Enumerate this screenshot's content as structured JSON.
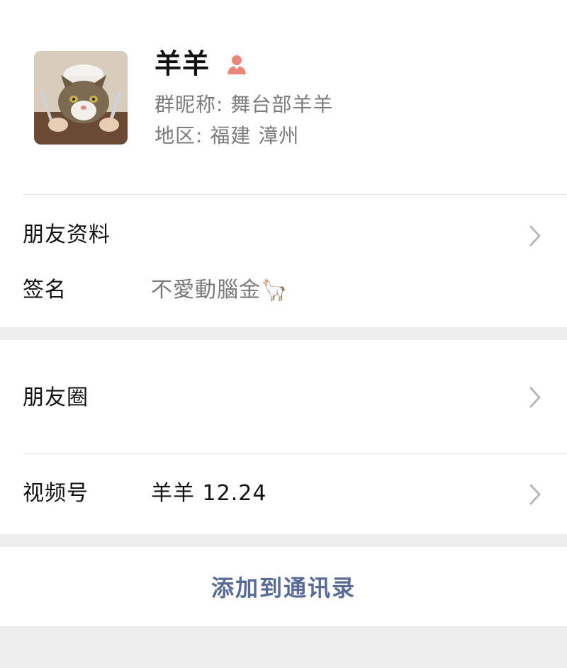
{
  "profile": {
    "avatar_icon": "cat-chef-avatar",
    "name": "羊羊",
    "gender_icon": "female-user-icon",
    "gender_color": "#e9877d",
    "nickname": "群昵称: 舞台部羊羊",
    "region": "地区: 福建 漳州"
  },
  "rows": {
    "friend_info": {
      "label": "朋友资料"
    },
    "signature": {
      "label": "签名",
      "value": "不愛動腦金",
      "emoji": "🦙"
    },
    "moments": {
      "label": "朋友圈"
    },
    "channels": {
      "label": "视频号",
      "value": "羊羊 12.24"
    }
  },
  "actions": {
    "add_to_contacts": "添加到通讯录",
    "link_color": "#576b95"
  }
}
